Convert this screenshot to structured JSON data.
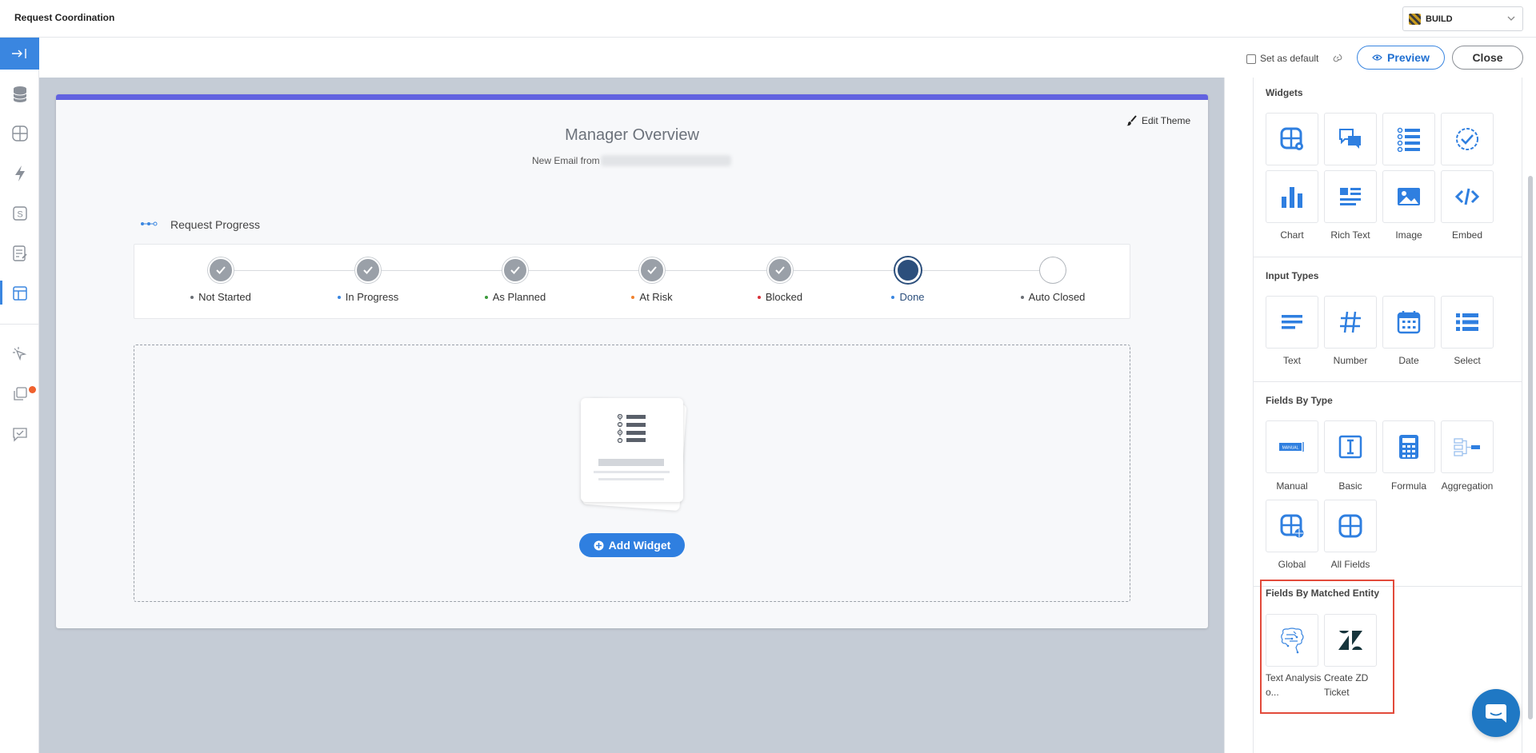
{
  "app": {
    "title": "Request Coordination"
  },
  "mode": {
    "label": "BUILD"
  },
  "toolbar": {
    "set_default_label": "Set as default",
    "preview_label": "Preview",
    "close_label": "Close"
  },
  "card": {
    "edit_theme_label": "Edit Theme",
    "title": "Manager Overview",
    "subtitle": "New Email from",
    "progress_label": "Request Progress",
    "steps": [
      {
        "label": "Not Started",
        "dot_color": "#6b6f75",
        "state": "complete"
      },
      {
        "label": "In Progress",
        "dot_color": "#3a86e0",
        "state": "complete"
      },
      {
        "label": "As Planned",
        "dot_color": "#3c9a3c",
        "state": "complete"
      },
      {
        "label": "At Risk",
        "dot_color": "#f0812e",
        "state": "complete"
      },
      {
        "label": "Blocked",
        "dot_color": "#d8323a",
        "state": "complete"
      },
      {
        "label": "Done",
        "dot_color": "#3a86e0",
        "state": "current"
      },
      {
        "label": "Auto Closed",
        "dot_color": "#6b6f75",
        "state": "pending"
      }
    ],
    "add_widget_label": "Add Widget"
  },
  "panel": {
    "widgets": {
      "title": "Widgets",
      "items": [
        "Chart",
        "Rich Text",
        "Image",
        "Embed"
      ]
    },
    "input_types": {
      "title": "Input Types",
      "items": [
        "Text",
        "Number",
        "Date",
        "Select"
      ]
    },
    "fields_by_type": {
      "title": "Fields By Type",
      "items": [
        "Manual",
        "Basic",
        "Formula",
        "Aggregation",
        "Global",
        "All Fields"
      ],
      "manual_badge": "MANUAL"
    },
    "matched_entity": {
      "title": "Fields By Matched Entity",
      "items": [
        "Text Analysis o...",
        "Create ZD Ticket"
      ]
    }
  },
  "colors": {
    "accent": "#3a86e0",
    "card_accent": "#6262e0",
    "highlight": "#e24a3b",
    "icon_blue": "#2f7fe0"
  }
}
